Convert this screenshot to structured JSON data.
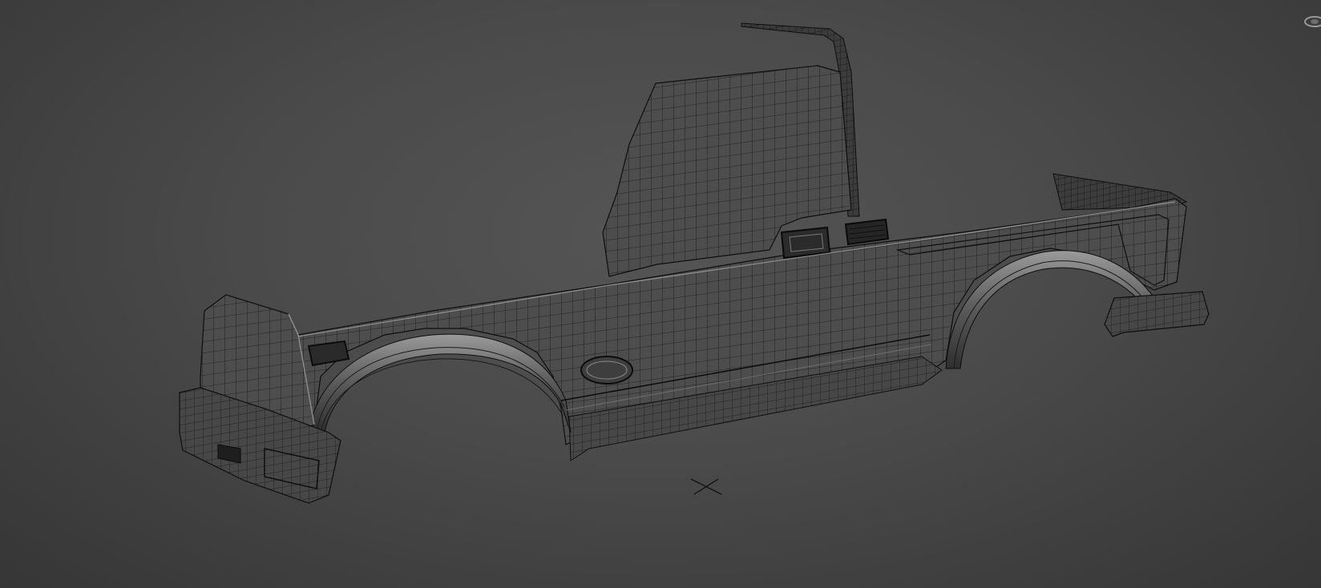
{
  "viewport": {
    "background": "#4a4a4a",
    "mesh_color": "#4c4c4c",
    "wire_color": "#111111",
    "highlight_color": "#9a9a9a"
  },
  "scene": {
    "object": "pickup-truck-body-wireframe",
    "pivot_marker": "x-cross-icon",
    "navigation_gizmo": "viewcube-icon"
  }
}
